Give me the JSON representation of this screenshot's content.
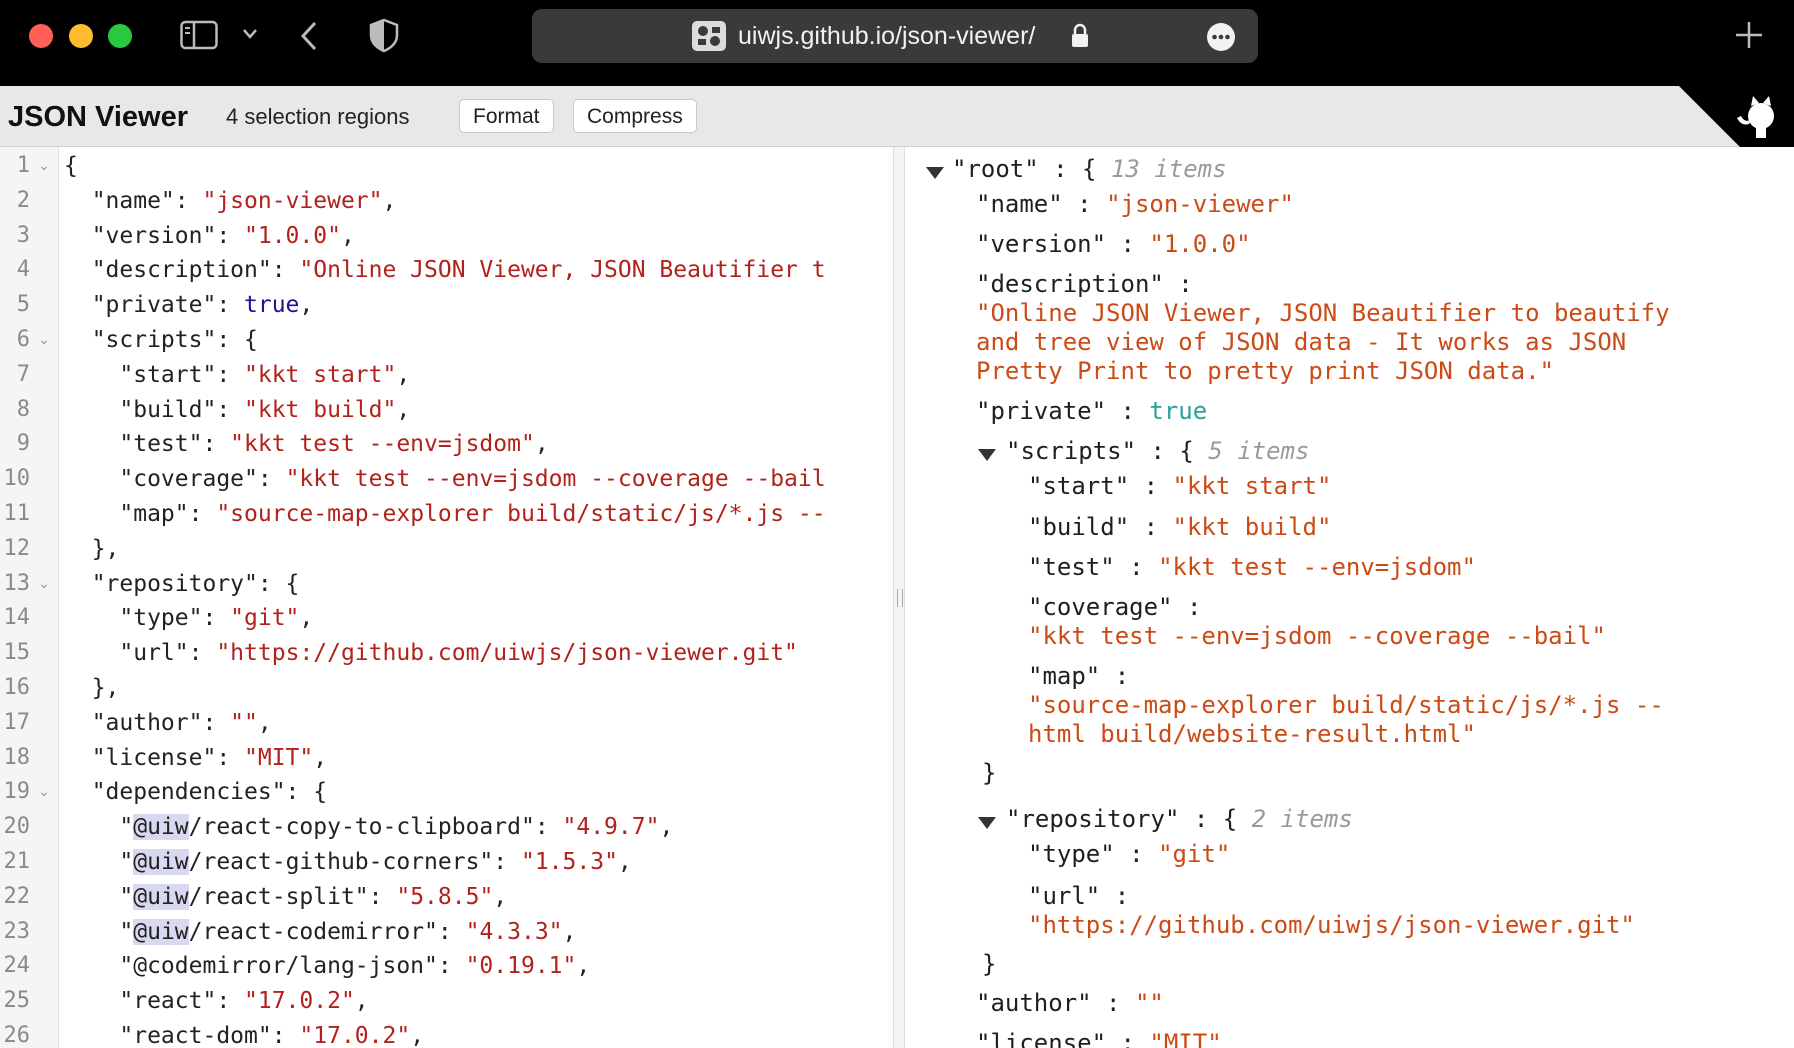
{
  "browser": {
    "url": "uiwjs.github.io/json-viewer/",
    "traffic_lights": [
      "#ff5f57",
      "#febc2e",
      "#28c840"
    ]
  },
  "toolbar": {
    "title": "JSON Viewer",
    "selection_info": "4 selection regions",
    "format_label": "Format",
    "compress_label": "Compress"
  },
  "editor": {
    "line_numbers": [
      "1",
      "2",
      "3",
      "4",
      "5",
      "6",
      "7",
      "8",
      "9",
      "10",
      "11",
      "12",
      "13",
      "14",
      "15",
      "16",
      "17",
      "18",
      "19",
      "20",
      "21",
      "22",
      "23",
      "24",
      "25",
      "26"
    ],
    "lines": [
      [
        "{"
      ],
      [
        "  \"name\": ",
        "\"json-viewer\"",
        ","
      ],
      [
        "  \"version\": ",
        "\"1.0.0\"",
        ","
      ],
      [
        "  \"description\": ",
        "\"Online JSON Viewer, JSON Beautifier t",
        ""
      ],
      [
        "  \"private\": ",
        "true",
        ","
      ],
      [
        "  \"scripts\": {"
      ],
      [
        "    \"start\": ",
        "\"kkt start\"",
        ","
      ],
      [
        "    \"build\": ",
        "\"kkt build\"",
        ","
      ],
      [
        "    \"test\": ",
        "\"kkt test --env=jsdom\"",
        ","
      ],
      [
        "    \"coverage\": ",
        "\"kkt test --env=jsdom --coverage --bail",
        ""
      ],
      [
        "    \"map\": ",
        "\"source-map-explorer build/static/js/*.js --",
        ""
      ],
      [
        "  },"
      ],
      [
        "  \"repository\": {"
      ],
      [
        "    \"type\": ",
        "\"git\"",
        ","
      ],
      [
        "    \"url\": ",
        "\"https://github.com/uiwjs/json-viewer.git\"",
        ""
      ],
      [
        "  },"
      ],
      [
        "  \"author\": ",
        "\"\"",
        ","
      ],
      [
        "  \"license\": ",
        "\"MIT\"",
        ","
      ],
      [
        "  \"dependencies\": {"
      ],
      [
        "    \"",
        "@uiw",
        "/react-copy-to-clipboard\": ",
        "\"4.9.7\"",
        ","
      ],
      [
        "    \"",
        "@uiw",
        "/react-github-corners\": ",
        "\"1.5.3\"",
        ","
      ],
      [
        "    \"",
        "@uiw",
        "/react-split\": ",
        "\"5.8.5\"",
        ","
      ],
      [
        "    \"",
        "@uiw",
        "/react-codemirror\": ",
        "\"4.3.3\"",
        ","
      ],
      [
        "    \"@codemirror/lang-json\": ",
        "\"0.19.1\"",
        ","
      ],
      [
        "    \"react\": ",
        "\"17.0.2\"",
        ","
      ],
      [
        "    \"react-dom\": ",
        "\"17.0.2\"",
        ","
      ]
    ]
  },
  "tree": {
    "root_key": "\"root\"",
    "root_count": "13 items",
    "name_key": "\"name\"",
    "name_val": "\"json-viewer\"",
    "version_key": "\"version\"",
    "version_val": "\"1.0.0\"",
    "description_key": "\"description\"",
    "description_val_1": "\"Online JSON Viewer, JSON Beautifier to beautify",
    "description_val_2": "and tree view of JSON data - It works as JSON",
    "description_val_3": "Pretty Print to pretty print JSON data.\"",
    "private_key": "\"private\"",
    "private_val": "true",
    "scripts_key": "\"scripts\"",
    "scripts_count": "5 items",
    "start_key": "\"start\"",
    "start_val": "\"kkt start\"",
    "build_key": "\"build\"",
    "build_val": "\"kkt build\"",
    "test_key": "\"test\"",
    "test_val": "\"kkt test --env=jsdom\"",
    "coverage_key": "\"coverage\"",
    "coverage_val": "\"kkt test --env=jsdom --coverage --bail\"",
    "map_key": "\"map\"",
    "map_val_1": "\"source-map-explorer build/static/js/*.js --",
    "map_val_2": "html build/website-result.html\"",
    "repository_key": "\"repository\"",
    "repository_count": "2 items",
    "type_key": "\"type\"",
    "type_val": "\"git\"",
    "url_key": "\"url\"",
    "url_val": "\"https://github.com/uiwjs/json-viewer.git\"",
    "author_key": "\"author\"",
    "author_val": "\"\"",
    "license_key": "\"license\"",
    "license_val": "\"MIT\""
  }
}
